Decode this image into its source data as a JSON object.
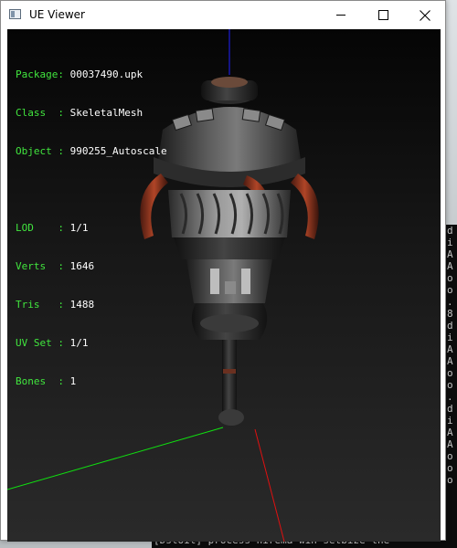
{
  "window": {
    "title": "UE Viewer",
    "minimize_label": "Minimize",
    "maximize_label": "Maximize",
    "close_label": "Close"
  },
  "mesh_info": {
    "package_label": "Package:",
    "package_value": "00037490.upk",
    "class_label": "Class  :",
    "class_value": "SkeletalMesh",
    "object_label": "Object :",
    "object_value": "990255_Autoscale",
    "lod_label": "LOD    :",
    "lod_value": "1/1",
    "verts_label": "Verts  :",
    "verts_value": "1646",
    "tris_label": "Tris   :",
    "tris_value": "1488",
    "uvset_label": "UV Set :",
    "uvset_value": "1/1",
    "bones_label": "Bones  :",
    "bones_value": "1"
  },
  "axes": {
    "x_color": "#e01010",
    "y_color": "#10e010",
    "z_color": "#2020ff"
  },
  "background_console": {
    "right_lines": [
      "d",
      "i",
      "A",
      "A",
      "o",
      "o",
      ".",
      "8",
      "d",
      "i",
      "A",
      "A",
      "o",
      "o",
      ".",
      "d",
      "i",
      "A",
      "A",
      "o",
      "o",
      "o"
    ],
    "bottom_line": "[Dstoit] process  hirema win setbize  the"
  },
  "icons": {
    "app": "app-window-icon",
    "minimize": "minimize-icon",
    "maximize": "maximize-icon",
    "close": "close-icon"
  }
}
